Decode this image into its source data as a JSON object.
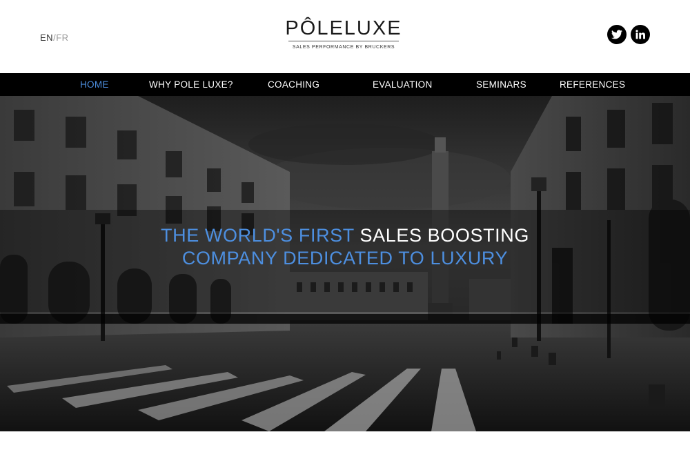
{
  "header": {
    "lang": {
      "active": "EN",
      "separator": "/",
      "inactive": "FR"
    },
    "logo": {
      "title": "PÔLELUXE",
      "subtitle": "SALES PERFORMANCE BY BRUCKERS"
    },
    "social": [
      "twitter-icon",
      "linkedin-icon"
    ]
  },
  "nav": {
    "items": [
      {
        "label": "HOME",
        "active": true
      },
      {
        "label": "WHY POLE LUXE?"
      },
      {
        "label": "COACHING"
      },
      {
        "label": "EVALUATION"
      },
      {
        "label": "SEMINARS"
      },
      {
        "label": "REFERENCES"
      }
    ]
  },
  "hero": {
    "line1_blue": "THE WORLD'S FIRST",
    "line1_white": "SALES BOOSTING",
    "line2_blue": "COMPANY DEDICATED TO LUXURY"
  },
  "colors": {
    "accent": "#4d8fe0",
    "nav_bg": "#000000"
  }
}
